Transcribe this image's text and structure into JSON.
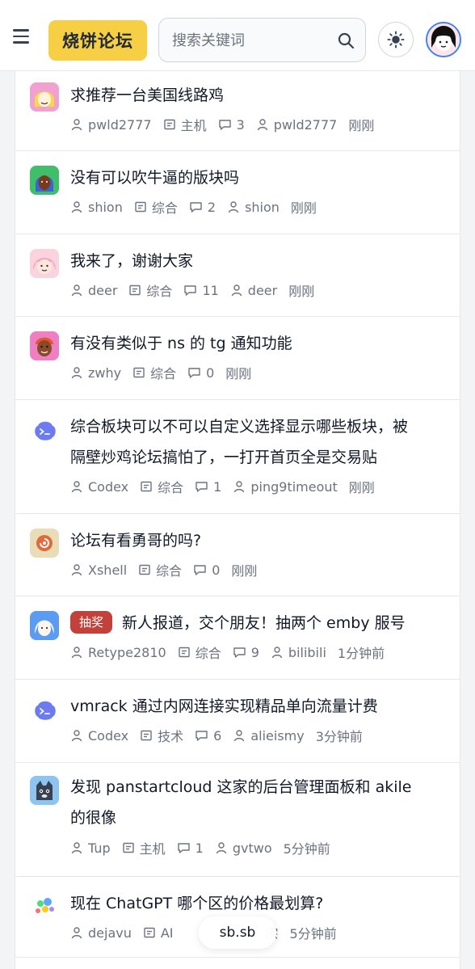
{
  "header": {
    "logo": "烧饼论坛",
    "search_placeholder": "搜索关键词",
    "menu_icon": "menu-icon",
    "search_icon": "search-icon",
    "theme_icon": "sun-icon",
    "colors": {
      "logo_bg": "#f7cf44",
      "badge": "#c2413a",
      "avatar_ring": "#3b82f6"
    }
  },
  "posts": [
    {
      "title": "求推荐一台美国线路鸡",
      "author": "pwld2777",
      "category": "主机",
      "replies": "3",
      "last_user": "pwld2777",
      "time": "刚刚"
    },
    {
      "title": "没有可以吹牛逼的版块吗",
      "author": "shion",
      "category": "综合",
      "replies": "2",
      "last_user": "shion",
      "time": "刚刚"
    },
    {
      "title": "我来了，谢谢大家",
      "author": "deer",
      "category": "综合",
      "replies": "11",
      "last_user": "deer",
      "time": "刚刚"
    },
    {
      "title": "有没有类似于 ns 的 tg 通知功能",
      "author": "zwhy",
      "category": "综合",
      "replies": "0",
      "time": "刚刚"
    },
    {
      "title_line1": "综合板块可以不可以自定义选择显示哪些板块，被",
      "title_line2": "隔壁炒鸡论坛搞怕了，一打开首页全是交易贴",
      "author": "Codex",
      "category": "综合",
      "replies": "1",
      "last_user": "ping9timeout",
      "time": "刚刚"
    },
    {
      "title": "论坛有看勇哥的吗?",
      "author": "Xshell",
      "category": "综合",
      "replies": "0",
      "time": "刚刚"
    },
    {
      "badge": "抽奖",
      "title": "新人报道，交个朋友！抽两个 emby 服号",
      "author": "Retype2810",
      "category": "综合",
      "replies": "9",
      "last_user": "bilibili",
      "time": "1分钟前"
    },
    {
      "title": "vmrack 通过内网连接实现精品单向流量计费",
      "author": "Codex",
      "category": "技术",
      "replies": "6",
      "last_user": "alieismy",
      "time": "3分钟前"
    },
    {
      "title_line1": "发现 panstartcloud 这家的后台管理面板和 akile",
      "title_line2": "的很像",
      "author": "Tup",
      "category": "主机",
      "replies": "1",
      "last_user": "gvtwo",
      "time": "5分钟前"
    },
    {
      "title": "现在 ChatGPT 哪个区的价格最划算?",
      "author": "dejavu",
      "category": "AI",
      "last_user_partial": "宗",
      "time": "5分钟前"
    }
  ],
  "footer_pill": "sb.sb"
}
